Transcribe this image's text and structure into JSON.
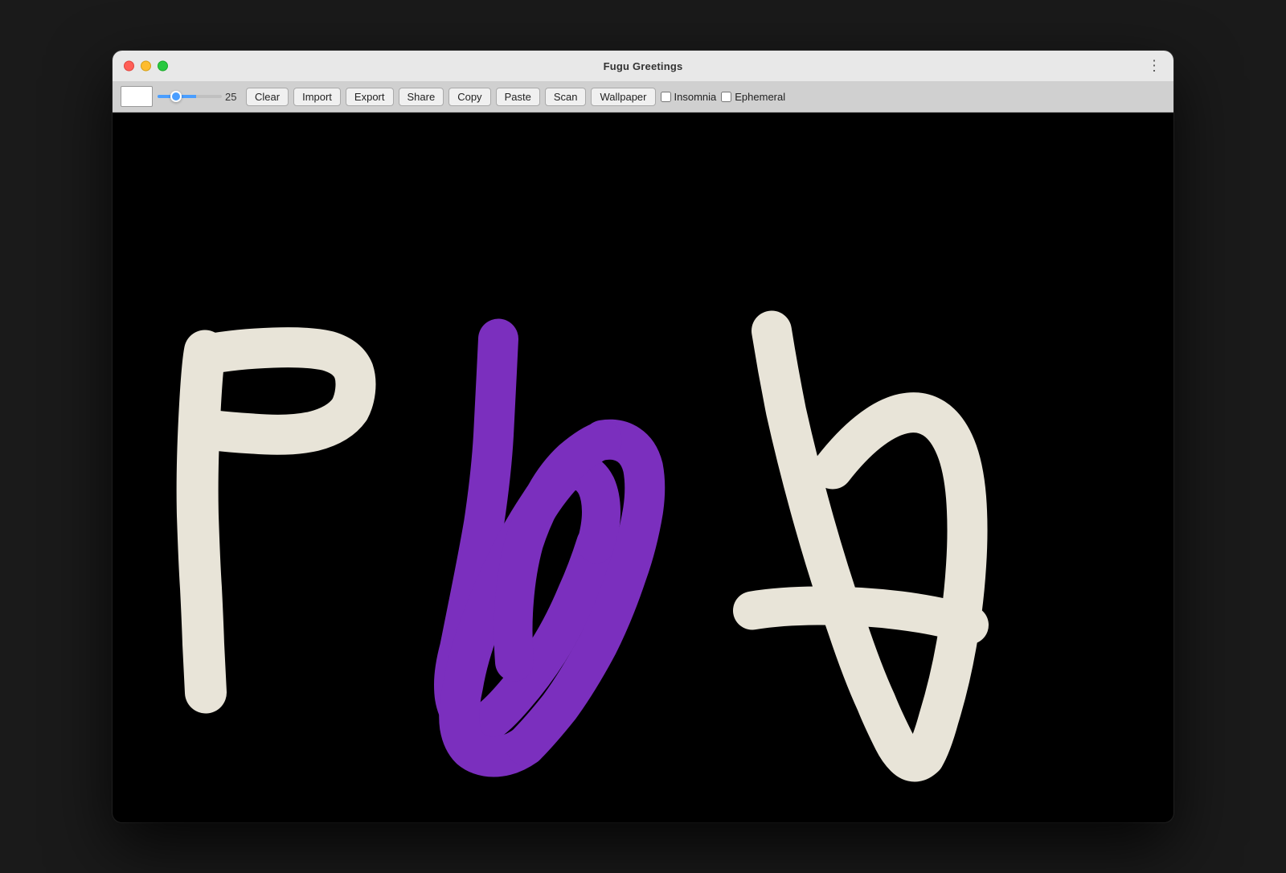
{
  "window": {
    "title": "Fugu Greetings"
  },
  "toolbar": {
    "brush_size_value": "25",
    "buttons": [
      {
        "id": "clear-button",
        "label": "Clear"
      },
      {
        "id": "import-button",
        "label": "Import"
      },
      {
        "id": "export-button",
        "label": "Export"
      },
      {
        "id": "share-button",
        "label": "Share"
      },
      {
        "id": "copy-button",
        "label": "Copy"
      },
      {
        "id": "paste-button",
        "label": "Paste"
      },
      {
        "id": "scan-button",
        "label": "Scan"
      },
      {
        "id": "wallpaper-button",
        "label": "Wallpaper"
      }
    ],
    "checkboxes": [
      {
        "id": "insomnia-checkbox",
        "label": "Insomnia",
        "checked": false
      },
      {
        "id": "ephemeral-checkbox",
        "label": "Ephemeral",
        "checked": false
      }
    ]
  },
  "colors": {
    "canvas_bg": "#000000",
    "letter_p_color": "#f0ece0",
    "letter_w_color": "#7b2fbe",
    "letter_a_color": "#f0ece0"
  }
}
